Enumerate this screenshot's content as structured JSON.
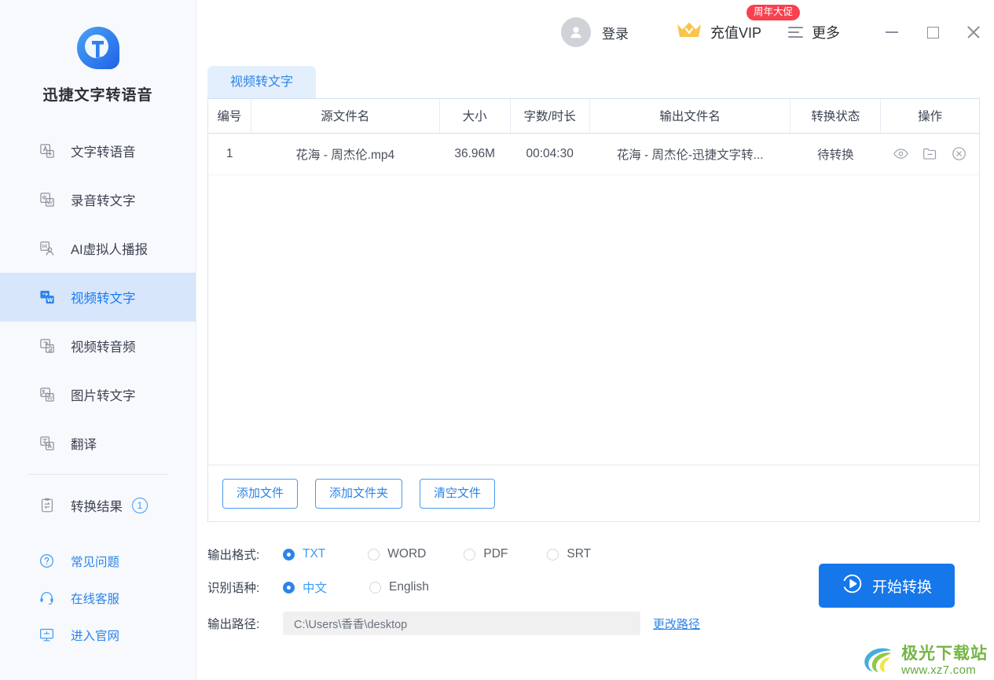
{
  "app": {
    "brand_name": "迅捷文字转语音",
    "logo_icon": "app-logo-icon"
  },
  "sidebar": {
    "items": [
      {
        "label": "文字转语音",
        "icon": "text-to-speech-icon",
        "active": false
      },
      {
        "label": "录音转文字",
        "icon": "audio-to-text-icon",
        "active": false
      },
      {
        "label": "AI虚拟人播报",
        "icon": "ai-avatar-icon",
        "active": false
      },
      {
        "label": "视频转文字",
        "icon": "video-to-text-icon",
        "active": true
      },
      {
        "label": "视频转音频",
        "icon": "video-to-audio-icon",
        "active": false
      },
      {
        "label": "图片转文字",
        "icon": "image-to-text-icon",
        "active": false
      },
      {
        "label": "翻译",
        "icon": "translate-icon",
        "active": false
      }
    ],
    "results": {
      "label": "转换结果",
      "count": "1",
      "icon": "clipboard-swap-icon"
    },
    "links": [
      {
        "label": "常见问题",
        "icon": "question-circle-icon"
      },
      {
        "label": "在线客服",
        "icon": "headset-icon"
      },
      {
        "label": "进入官网",
        "icon": "monitor-icon"
      }
    ]
  },
  "titlebar": {
    "login_label": "登录",
    "login_icon": "user-avatar-icon",
    "vip_label": "充值VIP",
    "vip_icon": "crown-icon",
    "promo_badge": "周年大促",
    "more_label": "更多",
    "more_icon": "hamburger-menu-icon",
    "minimize_icon": "minimize-icon",
    "maximize_icon": "maximize-icon",
    "close_icon": "close-icon"
  },
  "tabs": [
    {
      "label": "视频转文字",
      "active": true
    }
  ],
  "table": {
    "headers": [
      "编号",
      "源文件名",
      "大小",
      "字数/时长",
      "输出文件名",
      "转换状态",
      "操作"
    ],
    "rows": [
      {
        "no": "1",
        "source_name": "花海 - 周杰伦.mp4",
        "size": "36.96M",
        "duration": "00:04:30",
        "output_name": "花海 - 周杰伦-迅捷文字转...",
        "status": "待转换",
        "actions": [
          "preview-eye-icon",
          "open-folder-icon",
          "remove-circle-icon"
        ]
      }
    ]
  },
  "file_buttons": {
    "add_file": "添加文件",
    "add_folder": "添加文件夹",
    "clear_files": "清空文件"
  },
  "settings": {
    "format_label": "输出格式:",
    "format_options": [
      {
        "label": "TXT",
        "checked": true
      },
      {
        "label": "WORD",
        "checked": false
      },
      {
        "label": "PDF",
        "checked": false
      },
      {
        "label": "SRT",
        "checked": false
      }
    ],
    "language_label": "识别语种:",
    "language_options": [
      {
        "label": "中文",
        "checked": true
      },
      {
        "label": "English",
        "checked": false
      }
    ],
    "path_label": "输出路径:",
    "path_value": "C:\\Users\\香香\\desktop",
    "change_path_label": "更改路径",
    "start_label": "开始转换",
    "start_icon": "play-circle-icon"
  },
  "watermark": {
    "name": "极光下载站",
    "url": "www.xz7.com"
  },
  "colors": {
    "accent": "#2c84e8",
    "primary_button": "#1677ea",
    "active_nav_bg": "#d7e6fb",
    "promo_red": "#f9404f",
    "crown_gold": "#f8c44c",
    "sidebar_bg": "#f7f9fc"
  }
}
